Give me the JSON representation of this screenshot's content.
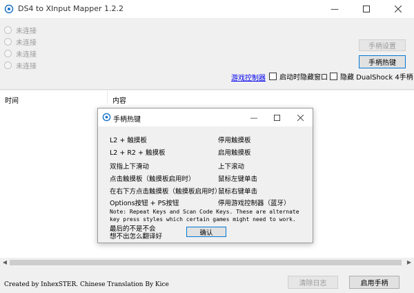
{
  "window": {
    "title": "DS4 to XInput Mapper 1.2.2"
  },
  "controllers": [
    "未连接",
    "未连接",
    "未连接",
    "未连接"
  ],
  "buttons": {
    "controller_settings": "手柄设置",
    "hotkeys": "手柄热键",
    "clear_log": "清除日志",
    "start": "启用手柄"
  },
  "options": {
    "game_controllers_link": "游戏控制器",
    "hide_on_start": "启动时隐藏窗口",
    "hide_ds4": "隐藏 DualShock 4手柄"
  },
  "log": {
    "col_time": "时间",
    "col_content": "内容"
  },
  "footer": {
    "credits": "Created by InhexSTER. Chinese Translation By Kice"
  },
  "dialog": {
    "title": "手柄热键",
    "rows": [
      {
        "key": "L2 + 触摸板",
        "value": "停用触摸板"
      },
      {
        "key": "L2 + R2 + 触摸板",
        "value": "启用触摸板"
      },
      {
        "key": "双指上下滑动",
        "value": "上下滚动"
      },
      {
        "key": "点击触摸板（触摸板启用时）",
        "value": "鼠标左键单击"
      },
      {
        "key": "在右下方点击触摸板（触摸板启用时）",
        "value": "鼠标右键单击"
      },
      {
        "key": "Options按钮 + PS按钮",
        "value": "停用游戏控制器（蓝牙）"
      }
    ],
    "note": "Note: Repeat Keys and Scan Code Keys. These are alternate key press styles which certain games might need to work.",
    "bottom_line1": "最后的不是不会",
    "bottom_line2": "想不出怎么翻译好",
    "ok": "确认"
  }
}
